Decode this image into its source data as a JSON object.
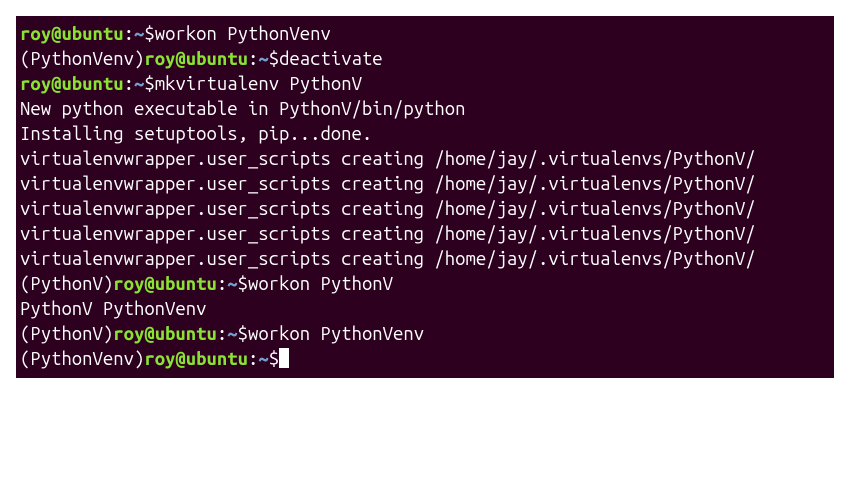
{
  "lines": [
    {
      "type": "prompt",
      "venv": "",
      "userhost": "roy@ubuntu",
      "path": "~",
      "command": "workon PythonVenv"
    },
    {
      "type": "prompt",
      "venv": "(PythonVenv)",
      "userhost": "roy@ubuntu",
      "path": "~",
      "command": "deactivate"
    },
    {
      "type": "prompt",
      "venv": "",
      "userhost": "roy@ubuntu",
      "path": "~",
      "command": "mkvirtualenv PythonV"
    },
    {
      "type": "output",
      "text": "New python executable in PythonV/bin/python"
    },
    {
      "type": "output",
      "text": "Installing setuptools, pip...done."
    },
    {
      "type": "output",
      "text": "virtualenvwrapper.user_scripts creating /home/jay/.virtualenvs/PythonV/"
    },
    {
      "type": "output",
      "text": "virtualenvwrapper.user_scripts creating /home/jay/.virtualenvs/PythonV/"
    },
    {
      "type": "output",
      "text": "virtualenvwrapper.user_scripts creating /home/jay/.virtualenvs/PythonV/"
    },
    {
      "type": "output",
      "text": "virtualenvwrapper.user_scripts creating /home/jay/.virtualenvs/PythonV/"
    },
    {
      "type": "output",
      "text": "virtualenvwrapper.user_scripts creating /home/jay/.virtualenvs/PythonV/"
    },
    {
      "type": "prompt",
      "venv": "(PythonV)",
      "userhost": "roy@ubuntu",
      "path": "~",
      "command": "workon PythonV"
    },
    {
      "type": "output",
      "text": "PythonV     PythonVenv"
    },
    {
      "type": "prompt",
      "venv": "(PythonV)",
      "userhost": "roy@ubuntu",
      "path": "~",
      "command": "workon PythonVenv"
    },
    {
      "type": "prompt",
      "venv": "(PythonVenv)",
      "userhost": "roy@ubuntu",
      "path": "~",
      "command": "",
      "cursor": true
    }
  ]
}
